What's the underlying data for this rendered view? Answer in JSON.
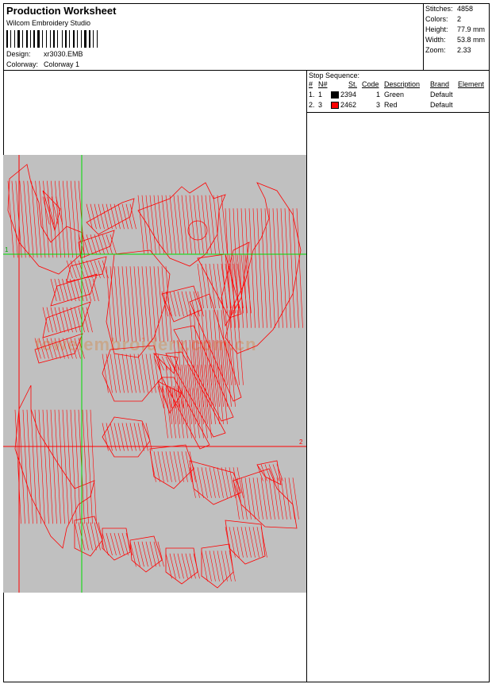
{
  "header": {
    "title": "Production Worksheet",
    "software": "Wilcom  Embroidery Studio",
    "design_label": "Design:",
    "design_value": "xr3030.EMB",
    "colorway_label": "Colorway:",
    "colorway_value": "Colorway 1"
  },
  "stats": [
    {
      "label": "Stitches:",
      "value": "4858"
    },
    {
      "label": "Colors:",
      "value": "2"
    },
    {
      "label": "Height:",
      "value": "77.9 mm"
    },
    {
      "label": "Width:",
      "value": "53.8 mm"
    },
    {
      "label": "Zoom:",
      "value": "2.33"
    }
  ],
  "stop_sequence": {
    "title": "Stop Sequence:",
    "columns": [
      "#",
      "N#",
      "St.",
      "Code",
      "Description",
      "Brand",
      "Element"
    ],
    "rows": [
      {
        "num": "1.",
        "n": "1",
        "color": "#000000",
        "stitches": "2394",
        "code": "1",
        "description": "Green",
        "brand": "Default",
        "element": ""
      },
      {
        "num": "2.",
        "n": "3",
        "color": "#ff0000",
        "stitches": "2462",
        "code": "3",
        "description": "Red",
        "brand": "Default",
        "element": ""
      }
    ]
  },
  "preview": {
    "background": "#c0c0c0",
    "stitch_color": "#ff0000",
    "guide_color": "#00dd00",
    "marker_1": "1",
    "marker_2": "2",
    "watermark": "towelembroidery.com.cn"
  }
}
